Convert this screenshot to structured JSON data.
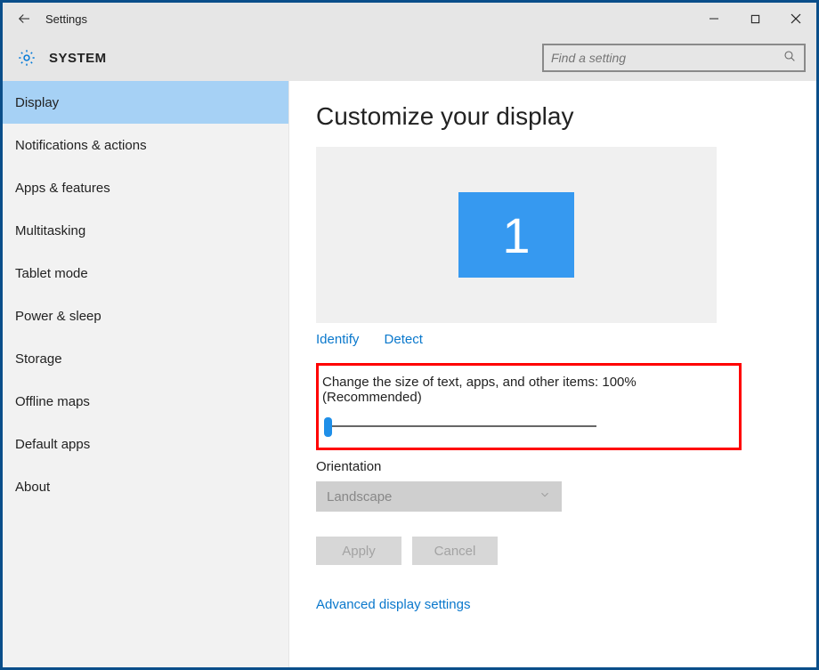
{
  "window": {
    "title": "Settings"
  },
  "header": {
    "title": "SYSTEM",
    "search_placeholder": "Find a setting"
  },
  "sidebar": {
    "items": [
      {
        "label": "Display",
        "selected": true
      },
      {
        "label": "Notifications & actions",
        "selected": false
      },
      {
        "label": "Apps & features",
        "selected": false
      },
      {
        "label": "Multitasking",
        "selected": false
      },
      {
        "label": "Tablet mode",
        "selected": false
      },
      {
        "label": "Power & sleep",
        "selected": false
      },
      {
        "label": "Storage",
        "selected": false
      },
      {
        "label": "Offline maps",
        "selected": false
      },
      {
        "label": "Default apps",
        "selected": false
      },
      {
        "label": "About",
        "selected": false
      }
    ]
  },
  "content": {
    "page_title": "Customize your display",
    "monitor_number": "1",
    "identify_link": "Identify",
    "detect_link": "Detect",
    "scale_label": "Change the size of text, apps, and other items: 100% (Recommended)",
    "scale_value_percent": 100,
    "orientation_label": "Orientation",
    "orientation_value": "Landscape",
    "apply_button": "Apply",
    "cancel_button": "Cancel",
    "advanced_link": "Advanced display settings"
  }
}
